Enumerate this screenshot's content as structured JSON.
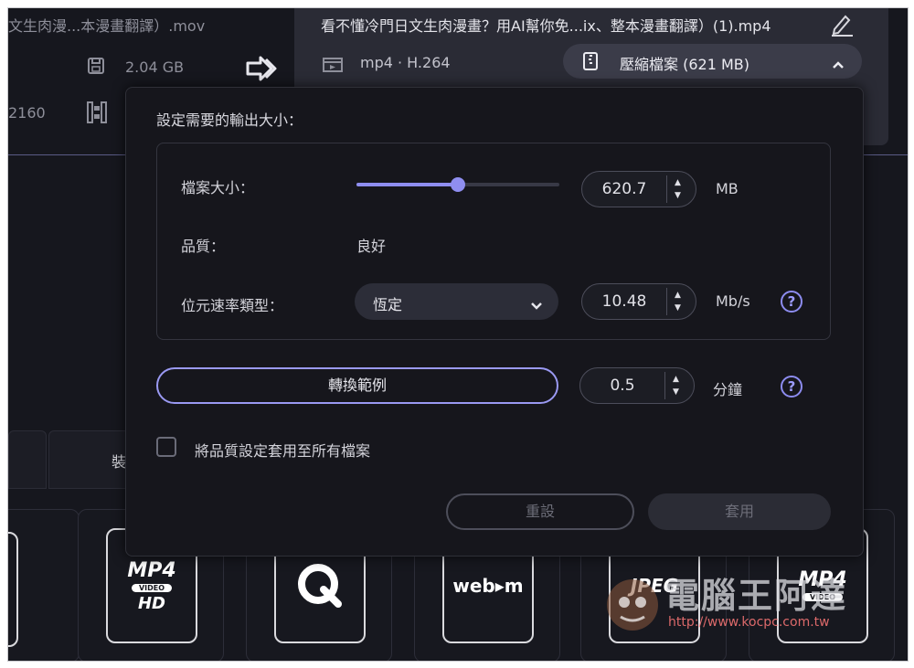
{
  "source": {
    "filename": "文生肉漫...本漫畫翻譯）.mov",
    "size": "2.04 GB",
    "resolution": "2160"
  },
  "output": {
    "filename": "看不懂冷門日文生肉漫畫？用AI幫你免...ix、整本漫畫翻譯）(1).mp4",
    "codec": "mp4 · H.264",
    "compress_label": "壓縮檔案 (621 MB)"
  },
  "dialog": {
    "title": "設定需要的輸出大小：",
    "file_size_label": "檔案大小：",
    "file_size_value": "620.7",
    "file_size_unit": "MB",
    "file_size_slider_fraction": 0.5,
    "quality_label": "品質：",
    "quality_value": "良好",
    "bitrate_type_label": "位元速率類型：",
    "bitrate_type_value": "恆定",
    "bitrate_value": "10.48",
    "bitrate_unit": "Mb/s",
    "preview_button": "轉換範例",
    "preview_duration": "0.5",
    "preview_unit": "分鐘",
    "apply_all_label": "將品質設定套用至所有檔案",
    "apply_all_checked": false,
    "reset_button": "重設",
    "apply_button": "套用",
    "help_glyph": "?"
  },
  "bottom": {
    "tab_partial": "裝",
    "formats": [
      {
        "name": "partial-format",
        "line1": ""
      },
      {
        "name": "mp4-hd",
        "line1": "MP4",
        "line2": "VIDEO",
        "line3": "HD"
      },
      {
        "name": "quicktime",
        "line1": "Q"
      },
      {
        "name": "webm",
        "line1": "web▸m"
      },
      {
        "name": "jpeg",
        "line1": "JPEG"
      },
      {
        "name": "mp4-video",
        "line1": "MP4",
        "line2": "VIDEO"
      }
    ]
  },
  "watermark": {
    "text": "電腦王阿達",
    "url": "http://www.kocpc.com.tw"
  },
  "colors": {
    "accent": "#8d8cf0",
    "background": "#16171e",
    "panel": "#2a2b35",
    "slider_fill": "#8f8ef0"
  }
}
